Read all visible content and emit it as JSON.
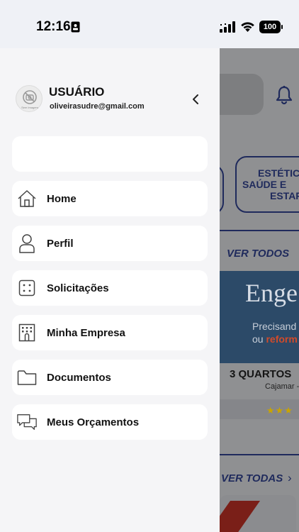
{
  "status_bar": {
    "time": "12:16",
    "battery": "100"
  },
  "drawer": {
    "avatar_caption": "Sem Imagem",
    "user_name": "USUÁRIO",
    "user_email": "oliveirasudre@gmail.com",
    "menu": [
      {
        "label": "Home",
        "icon": "home-icon"
      },
      {
        "label": "Perfil",
        "icon": "user-icon"
      },
      {
        "label": "Solicitações",
        "icon": "dice-icon"
      },
      {
        "label": "Minha Empresa",
        "icon": "building-icon"
      },
      {
        "label": "Documentos",
        "icon": "folder-icon"
      },
      {
        "label": "Meus Orçamentos",
        "icon": "chat-bubbles-icon"
      }
    ]
  },
  "background": {
    "category_line1": "ESTÉTIC",
    "category_line2": "SAÚDE E",
    "category_line3": "ESTAR",
    "see_all_services": "VER TODOS",
    "banner_title": "Enge",
    "banner_line1": "Precisand",
    "banner_line2_prefix": "ou",
    "banner_line2_highlight": "reform",
    "listing_title": "3 QUARTOS",
    "listing_city": "Cajamar -",
    "rating_stars": "★★★",
    "see_all_listings": "VER TODAS",
    "colors": {
      "brand_navy": "#1f2a5c",
      "accent_red": "#d24b2a"
    }
  }
}
